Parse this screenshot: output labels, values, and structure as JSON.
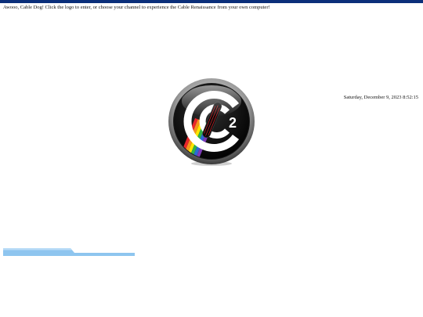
{
  "header": {
    "bar_color": "#0b2f7a",
    "welcome_text": "Awooo, Cable Dog! Click the logo to enter, or choose your channel to experience the Cable Renaissance from your own computer!"
  },
  "clock": {
    "datetime": "Saturday, December 9, 2023 8:52:15"
  },
  "logo": {
    "icon": "c2-cable-logo-icon",
    "mark_text": "2"
  },
  "channel_selector": {
    "icon": "channel-tab-icon",
    "color": "#8ec5ef"
  }
}
